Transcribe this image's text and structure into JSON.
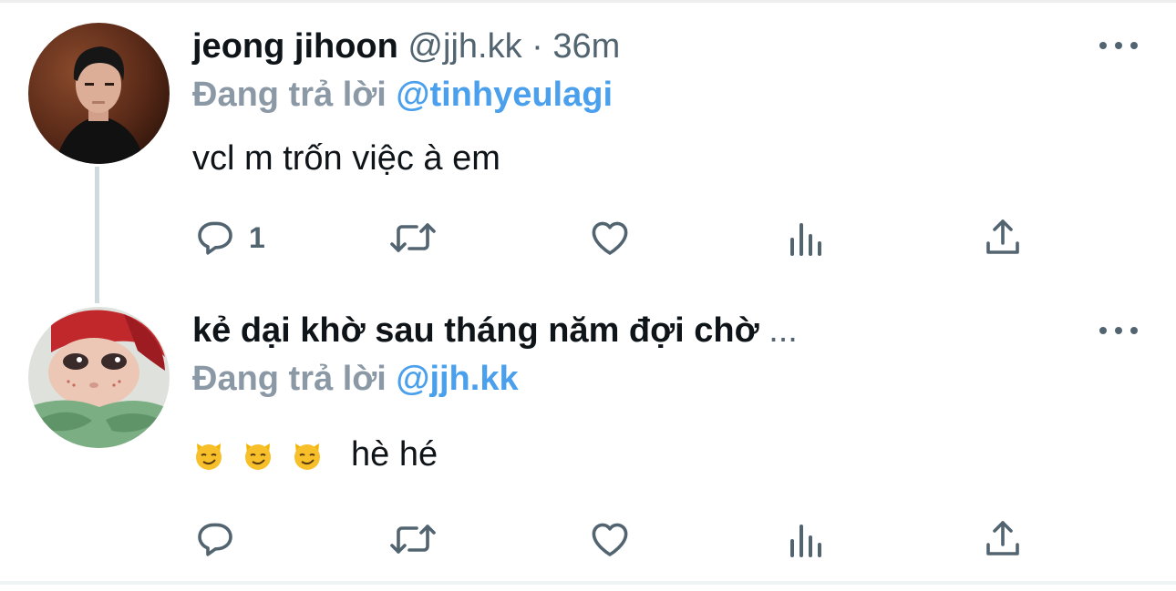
{
  "tweets": [
    {
      "name": "jeong jihoon",
      "handle": "@jjh.kk",
      "separator": "·",
      "time": "36m",
      "reply_prefix": "Đang trả lời",
      "reply_to": "@tinhyeulagi",
      "text": "vcl m trốn việc à em",
      "reply_count": "1",
      "avatar_icon": "user-photo-avatar"
    },
    {
      "name": "kẻ dại khờ sau tháng năm đợi chờ",
      "name_truncation": "...",
      "reply_prefix": "Đang trả lời",
      "reply_to": "@jjh.kk",
      "emojis": [
        "smirking-cat-emoji",
        "smirking-cat-emoji",
        "smirking-cat-emoji"
      ],
      "text": "hè hé",
      "reply_count": "",
      "avatar_icon": "flower-figure-avatar"
    }
  ],
  "colors": {
    "text": "#0f1419",
    "secondary": "#536471",
    "reply_prefix": "#8b98a5",
    "mention": "#4aa0ec",
    "thread_line": "#cfd9de"
  },
  "action_icons": [
    "reply-icon",
    "retweet-icon",
    "like-icon",
    "views-icon",
    "share-icon"
  ]
}
